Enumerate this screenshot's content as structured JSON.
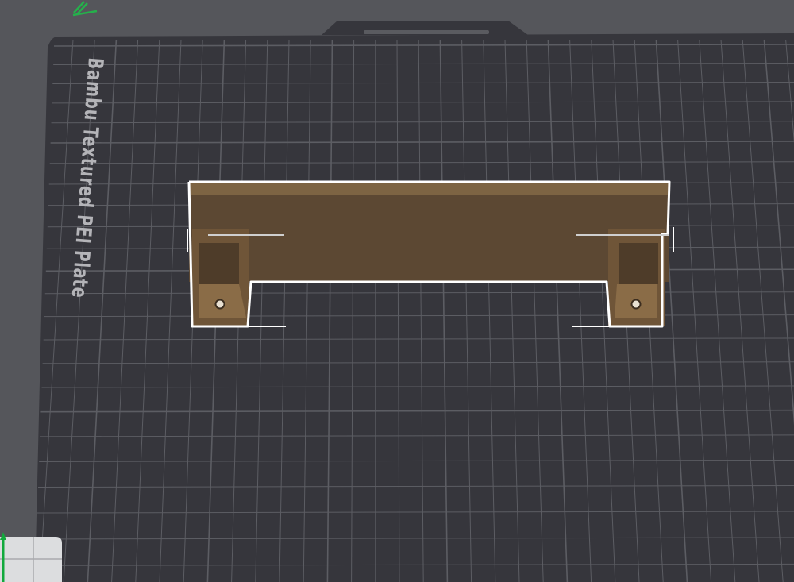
{
  "viewport": {
    "plate_label": "Bambu Textured PEI Plate",
    "background_color": "#55565b",
    "plate_color": "#36363c",
    "grid_color": "#5c5d63",
    "model_color": "#6b5436",
    "selection_color": "#ffffff"
  },
  "icons": {
    "top_marker": "pencil-marker-icon",
    "axis_gizmo": "axis-gizmo-icon"
  }
}
